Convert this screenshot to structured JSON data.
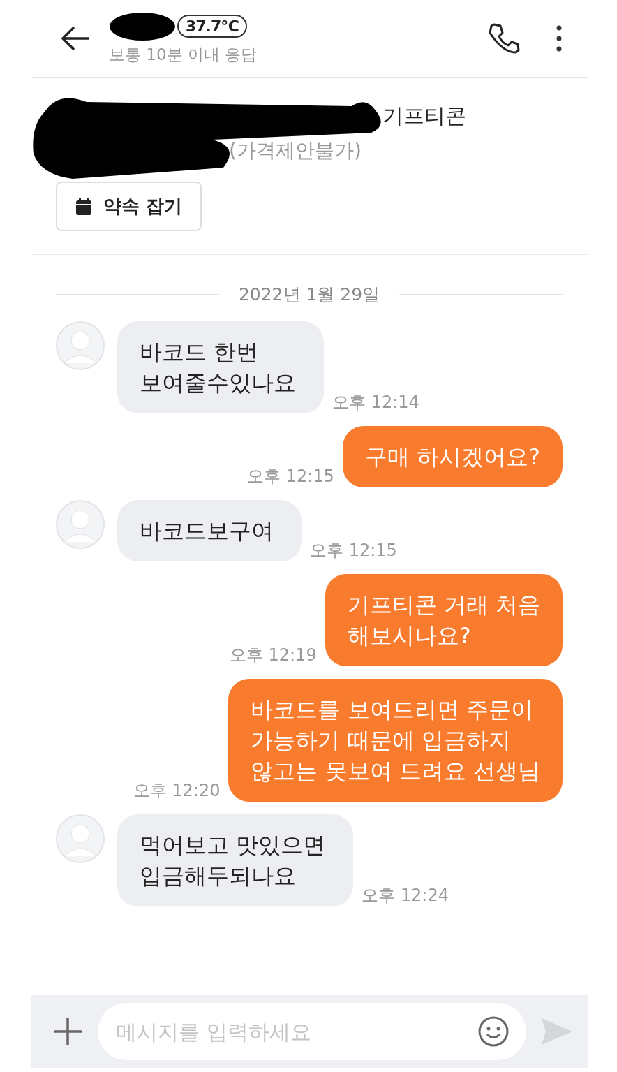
{
  "header": {
    "temperature": "37.7℃",
    "response_note": "보통 10분 이내 응답"
  },
  "product": {
    "title": "기프티콘",
    "price": "(가격제안불가)",
    "appointment_button": "약속 잡기"
  },
  "date_divider": "2022년 1월 29일",
  "messages": [
    {
      "kind": "incoming",
      "text": "바코드 한번\n보여줄수있나요",
      "time": "오후 12:14"
    },
    {
      "kind": "outgoing",
      "text": "구매 하시겠어요?",
      "time": "오후 12:15"
    },
    {
      "kind": "incoming",
      "text": "바코드보구여",
      "time": "오후 12:15"
    },
    {
      "kind": "outgoing",
      "text": "기프티콘 거래 처음\n해보시나요?",
      "time": "오후 12:19"
    },
    {
      "kind": "outgoing",
      "text": "바코드를 보여드리면 주문이\n가능하기 때문에 입금하지\n않고는 못보여 드려요 선생님",
      "time": "오후 12:20"
    },
    {
      "kind": "incoming",
      "text": "먹어보고 맛있으면\n입금해두되나요",
      "time": "오후 12:24"
    }
  ],
  "composer": {
    "placeholder": "메시지를 입력하세요"
  }
}
